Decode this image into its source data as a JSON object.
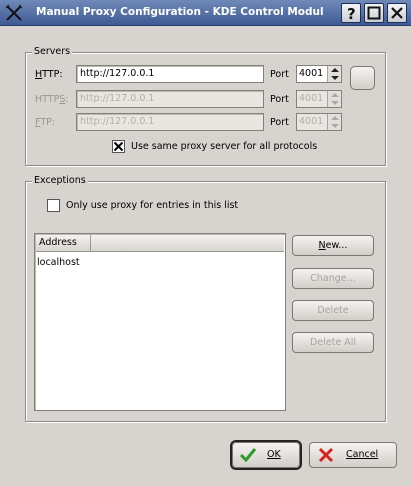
{
  "window": {
    "title": "Manual Proxy Configuration - KDE Control Modul",
    "buttons": [
      "help",
      "maximize",
      "close"
    ]
  },
  "servers": {
    "title": "Servers",
    "rows": [
      {
        "label": "HTTP:",
        "value": "http://127.0.0.1",
        "port_label": "Port",
        "port": "4001",
        "enabled": true
      },
      {
        "label": "HTTPS:",
        "value": "http://127.0.0.1",
        "port_label": "Port",
        "port": "4001",
        "enabled": false
      },
      {
        "label": "FTP:",
        "value": "http://127.0.0.1",
        "port_label": "Port",
        "port": "4001",
        "enabled": false
      }
    ],
    "same_proxy_label": "Use same proxy server for all protocols",
    "same_proxy_checked": true
  },
  "exceptions": {
    "title": "Exceptions",
    "only_use_label": "Only use proxy for entries in this list",
    "only_use_checked": false,
    "list": {
      "columns": [
        "Address"
      ],
      "rows": [
        "localhost"
      ]
    },
    "buttons": {
      "new": "New...",
      "change": "Change...",
      "delete": "Delete",
      "delete_all": "Delete All"
    }
  },
  "footer": {
    "ok": "OK",
    "cancel": "Cancel"
  },
  "colors": {
    "titlebar": "#4b66a0",
    "ok_check": "#2e9a2e",
    "cancel_x": "#d82020"
  }
}
